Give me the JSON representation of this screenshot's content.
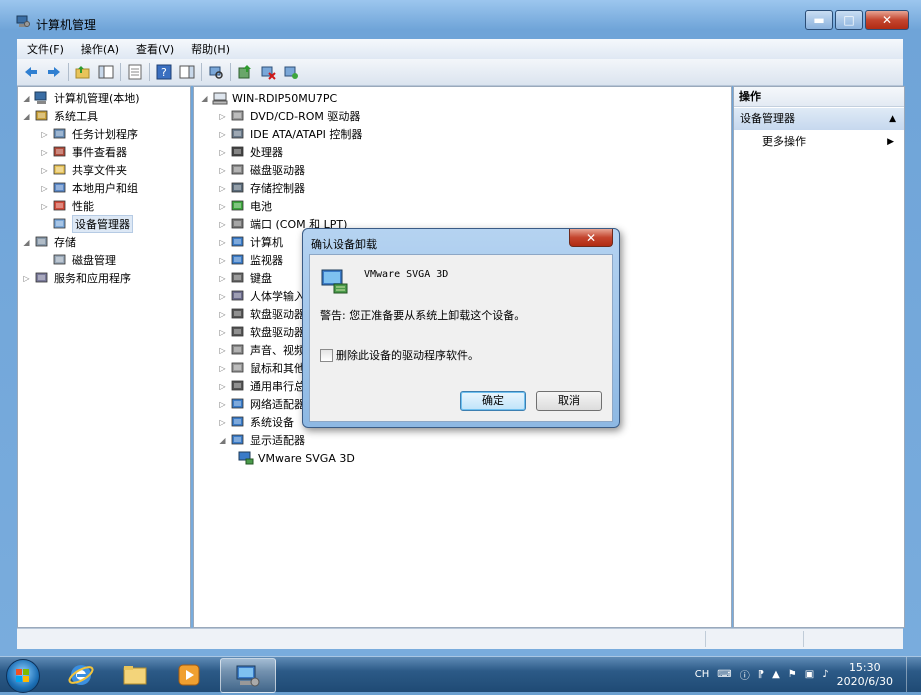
{
  "window": {
    "title": "计算机管理"
  },
  "menubar": [
    "文件(F)",
    "操作(A)",
    "查看(V)",
    "帮助(H)"
  ],
  "left_tree": {
    "root": "计算机管理(本地)",
    "items": [
      {
        "label": "系统工具",
        "level": 1,
        "expander": "◢",
        "icon": "tools-icon"
      },
      {
        "label": "任务计划程序",
        "level": 2,
        "expander": "▷",
        "icon": "clock-icon"
      },
      {
        "label": "事件查看器",
        "level": 2,
        "expander": "▷",
        "icon": "event-viewer-icon"
      },
      {
        "label": "共享文件夹",
        "level": 2,
        "expander": "▷",
        "icon": "shared-folder-icon"
      },
      {
        "label": "本地用户和组",
        "level": 2,
        "expander": "▷",
        "icon": "users-icon"
      },
      {
        "label": "性能",
        "level": 2,
        "expander": "▷",
        "icon": "performance-icon"
      },
      {
        "label": "设备管理器",
        "level": 2,
        "expander": "",
        "icon": "device-manager-icon",
        "selected": true
      },
      {
        "label": "存储",
        "level": 1,
        "expander": "◢",
        "icon": "storage-icon"
      },
      {
        "label": "磁盘管理",
        "level": 2,
        "expander": "",
        "icon": "disk-icon"
      },
      {
        "label": "服务和应用程序",
        "level": 1,
        "expander": "▷",
        "icon": "services-icon"
      }
    ]
  },
  "device_tree": {
    "root": "WIN-RDIP50MU7PC",
    "items": [
      {
        "label": "DVD/CD-ROM 驱动器",
        "icon": "dvd-icon"
      },
      {
        "label": "IDE ATA/ATAPI 控制器",
        "icon": "ide-icon"
      },
      {
        "label": "处理器",
        "icon": "cpu-icon"
      },
      {
        "label": "磁盘驱动器",
        "icon": "disk-drive-icon"
      },
      {
        "label": "存储控制器",
        "icon": "storage-controller-icon"
      },
      {
        "label": "电池",
        "icon": "battery-icon"
      },
      {
        "label": "端口 (COM 和 LPT)",
        "icon": "port-icon"
      },
      {
        "label": "计算机",
        "icon": "computer-icon"
      },
      {
        "label": "监视器",
        "icon": "monitor-icon"
      },
      {
        "label": "键盘",
        "icon": "keyboard-icon"
      },
      {
        "label": "人体学输入",
        "icon": "hid-icon"
      },
      {
        "label": "软盘驱动器",
        "icon": "floppy-drive-icon"
      },
      {
        "label": "软盘驱动器",
        "icon": "floppy-controller-icon"
      },
      {
        "label": "声音、视频",
        "icon": "sound-icon"
      },
      {
        "label": "鼠标和其他",
        "icon": "mouse-icon"
      },
      {
        "label": "通用串行总",
        "icon": "usb-icon"
      },
      {
        "label": "网络适配器",
        "icon": "network-icon"
      },
      {
        "label": "系统设备",
        "icon": "system-device-icon"
      },
      {
        "label": "显示适配器",
        "icon": "display-adapter-icon",
        "expanded": true
      }
    ],
    "child": "VMware SVGA 3D"
  },
  "actions": {
    "header": "操作",
    "selected": "设备管理器",
    "more": "更多操作"
  },
  "dialog": {
    "title": "确认设备卸载",
    "device_name": "VMware SVGA 3D",
    "warning": "警告: 您正准备要从系统上卸载这个设备。",
    "checkbox_label": "删除此设备的驱动程序软件。",
    "checkbox_checked": false,
    "ok": "确定",
    "cancel": "取消"
  },
  "taskbar": {
    "language": "CH",
    "time": "15:30",
    "date": "2020/6/30"
  }
}
